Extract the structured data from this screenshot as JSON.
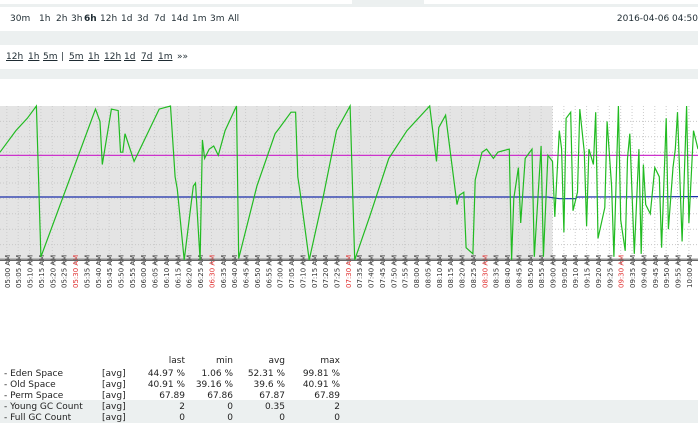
{
  "zoom": {
    "items": [
      {
        "label": "30m"
      },
      {
        "label": "1h"
      },
      {
        "label": "2h"
      },
      {
        "label": "3h"
      },
      {
        "label": "6h",
        "active": true
      },
      {
        "label": "12h"
      },
      {
        "label": "1d"
      },
      {
        "label": "3d"
      },
      {
        "label": "7d"
      },
      {
        "label": "14d"
      },
      {
        "label": "1m"
      },
      {
        "label": "3m"
      },
      {
        "label": "All"
      }
    ],
    "date_text": "2016-04-06 04:50"
  },
  "nav": {
    "back": [
      "12h",
      "1h",
      "5m"
    ],
    "separator": "|",
    "forward": [
      "5m",
      "1h",
      "12h",
      "1d",
      "7d",
      "1m"
    ],
    "more": "»»"
  },
  "chart_data": {
    "type": "line",
    "x_start": "04:57",
    "x_end": "10:04",
    "x_tick_labels": [
      "05:00 AM",
      "05:05 AM",
      "05:10 AM",
      "05:15 AM",
      "05:20 AM",
      "05:25 AM",
      "05:30 AM",
      "05:35 AM",
      "05:40 AM",
      "05:45 AM",
      "05:50 AM",
      "05:55 AM",
      "06:00 AM",
      "06:05 AM",
      "06:10 AM",
      "06:15 AM",
      "06:20 AM",
      "06:25 AM",
      "06:30 AM",
      "06:35 AM",
      "06:40 AM",
      "06:45 AM",
      "06:50 AM",
      "06:55 AM",
      "07:00 AM",
      "07:05 AM",
      "07:10 AM",
      "07:15 AM",
      "07:20 AM",
      "07:25 AM",
      "07:30 AM",
      "07:35 AM",
      "07:40 AM",
      "07:45 AM",
      "07:50 AM",
      "07:55 AM",
      "08:00 AM",
      "08:05 AM",
      "08:10 AM",
      "08:15 AM",
      "08:20 AM",
      "08:25 AM",
      "08:30 AM",
      "08:35 AM",
      "08:40 AM",
      "08:45 AM",
      "08:50 AM",
      "08:55 AM",
      "09:00 AM",
      "09:05 AM",
      "09:10 AM",
      "09:15 AM",
      "09:20 AM",
      "09:25 AM",
      "09:30 AM",
      "09:35 AM",
      "09:40 AM",
      "09:45 AM",
      "09:50 AM",
      "09:55 AM",
      "10:00 AM"
    ],
    "highlight_ticks": [
      "05:30 AM",
      "06:30 AM",
      "07:30 AM",
      "08:30 AM",
      "09:30 AM"
    ],
    "ylim": [
      0,
      100
    ],
    "shaded_until": "09:00",
    "grid": true,
    "series": [
      {
        "color": "#22bb22",
        "points": [
          [
            "04:57",
            70
          ],
          [
            "05:04",
            84
          ],
          [
            "05:09",
            92
          ],
          [
            "05:13",
            100
          ],
          [
            "05:15",
            2
          ],
          [
            "05:39",
            98
          ],
          [
            "05:41",
            90
          ],
          [
            "05:42",
            62
          ],
          [
            "05:46",
            98
          ],
          [
            "05:49",
            97
          ],
          [
            "05:50",
            70
          ],
          [
            "05:51",
            70
          ],
          [
            "05:52",
            82
          ],
          [
            "05:56",
            64
          ],
          [
            "06:07",
            98
          ],
          [
            "06:12",
            100
          ],
          [
            "06:14",
            54
          ],
          [
            "06:15",
            46
          ],
          [
            "06:18",
            0
          ],
          [
            "06:22",
            48
          ],
          [
            "06:23",
            50
          ],
          [
            "06:25",
            0
          ],
          [
            "06:26",
            78
          ],
          [
            "06:27",
            66
          ],
          [
            "06:29",
            72
          ],
          [
            "06:31",
            74
          ],
          [
            "06:33",
            68
          ],
          [
            "06:36",
            84
          ],
          [
            "06:41",
            100
          ],
          [
            "06:42",
            1
          ],
          [
            "06:50",
            48
          ],
          [
            "06:58",
            82
          ],
          [
            "07:00",
            86
          ],
          [
            "07:05",
            96
          ],
          [
            "07:07",
            96
          ],
          [
            "07:08",
            54
          ],
          [
            "07:09",
            44
          ],
          [
            "07:13",
            0
          ],
          [
            "07:19",
            40
          ],
          [
            "07:25",
            84
          ],
          [
            "07:31",
            100
          ],
          [
            "07:33",
            0
          ],
          [
            "07:40",
            30
          ],
          [
            "07:48",
            66
          ],
          [
            "07:56",
            84
          ],
          [
            "08:06",
            100
          ],
          [
            "08:09",
            64
          ],
          [
            "08:10",
            86
          ],
          [
            "08:13",
            94
          ],
          [
            "08:18",
            36
          ],
          [
            "08:19",
            42
          ],
          [
            "08:21",
            44
          ],
          [
            "08:22",
            8
          ],
          [
            "08:25",
            4
          ],
          [
            "08:26",
            52
          ],
          [
            "08:29",
            70
          ],
          [
            "08:31",
            72
          ],
          [
            "08:34",
            66
          ],
          [
            "08:36",
            70
          ],
          [
            "08:41",
            72
          ],
          [
            "08:42",
            0
          ],
          [
            "08:43",
            40
          ],
          [
            "08:45",
            60
          ],
          [
            "08:46",
            24
          ],
          [
            "08:48",
            66
          ],
          [
            "08:51",
            72
          ],
          [
            "08:52",
            2
          ],
          [
            "08:55",
            74
          ],
          [
            "08:56",
            2
          ],
          [
            "08:58",
            68
          ],
          [
            "09:00",
            64
          ],
          [
            "09:01",
            28
          ],
          [
            "09:03",
            84
          ],
          [
            "09:04",
            72
          ],
          [
            "09:05",
            18
          ],
          [
            "09:06",
            92
          ],
          [
            "09:08",
            96
          ],
          [
            "09:09",
            32
          ],
          [
            "09:11",
            44
          ],
          [
            "09:12",
            98
          ],
          [
            "09:14",
            70
          ],
          [
            "09:15",
            22
          ],
          [
            "09:16",
            72
          ],
          [
            "09:18",
            62
          ],
          [
            "09:19",
            96
          ],
          [
            "09:20",
            14
          ],
          [
            "09:23",
            34
          ],
          [
            "09:24",
            90
          ],
          [
            "09:26",
            48
          ],
          [
            "09:27",
            2
          ],
          [
            "09:29",
            100
          ],
          [
            "09:30",
            26
          ],
          [
            "09:32",
            6
          ],
          [
            "09:33",
            66
          ],
          [
            "09:34",
            82
          ],
          [
            "09:36",
            4
          ],
          [
            "09:38",
            72
          ],
          [
            "09:39",
            4
          ],
          [
            "09:40",
            62
          ],
          [
            "09:41",
            36
          ],
          [
            "09:43",
            30
          ],
          [
            "09:45",
            60
          ],
          [
            "09:47",
            54
          ],
          [
            "09:48",
            8
          ],
          [
            "09:50",
            92
          ],
          [
            "09:51",
            20
          ],
          [
            "09:53",
            60
          ],
          [
            "09:54",
            72
          ],
          [
            "09:55",
            96
          ],
          [
            "09:57",
            12
          ],
          [
            "09:59",
            100
          ],
          [
            "10:00",
            24
          ],
          [
            "10:02",
            84
          ],
          [
            "10:04",
            72
          ]
        ]
      },
      {
        "color": "#1a2faa",
        "points": [
          [
            "04:57",
            40.9
          ],
          [
            "08:58",
            40.9
          ],
          [
            "09:03",
            39.8
          ],
          [
            "09:10",
            39.8
          ],
          [
            "09:11",
            40.9
          ],
          [
            "10:04",
            41.2
          ]
        ]
      },
      {
        "color": "#cc33cc",
        "points": [
          [
            "04:57",
            67.9
          ],
          [
            "10:04",
            67.9
          ]
        ]
      },
      {
        "color": "#777777",
        "points": [
          [
            "04:57",
            0.5
          ],
          [
            "10:04",
            0.5
          ]
        ]
      }
    ]
  },
  "legend": {
    "headers": [
      "last",
      "min",
      "avg",
      "max"
    ],
    "rows": [
      {
        "name": "- Eden Space",
        "type": "[avg]",
        "last": "44.97 %",
        "min": "1.06 %",
        "avg": "52.31 %",
        "max": "99.81 %"
      },
      {
        "name": "- Old Space",
        "type": "[avg]",
        "last": "40.91 %",
        "min": "39.16 %",
        "avg": "39.6 %",
        "max": "40.91 %"
      },
      {
        "name": "- Perm Space",
        "type": "[avg]",
        "last": "67.89",
        "min": "67.86",
        "avg": "67.87",
        "max": "67.89"
      },
      {
        "name": "- Young GC Count",
        "type": "[avg]",
        "last": "2",
        "min": "0",
        "avg": "0.35",
        "max": "2"
      },
      {
        "name": "- Full GC Count",
        "type": "[avg]",
        "last": "0",
        "min": "0",
        "avg": "0",
        "max": "0"
      }
    ]
  }
}
